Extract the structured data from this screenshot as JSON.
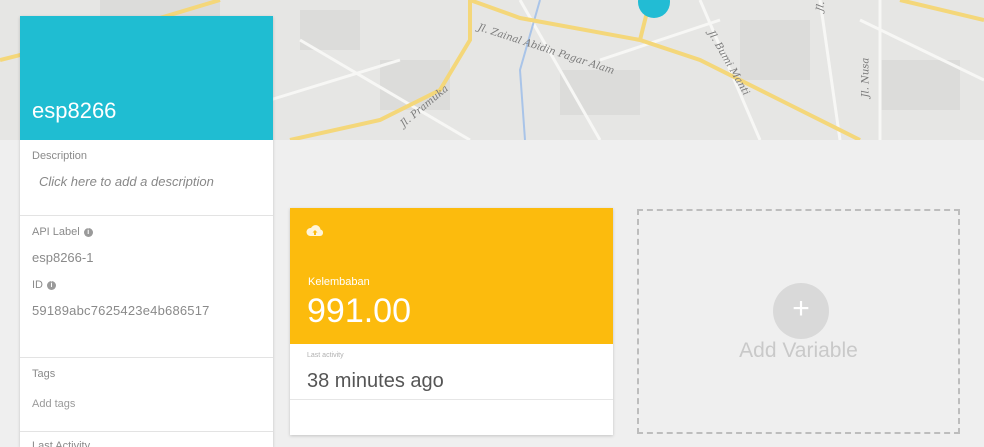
{
  "map": {
    "streets": [
      "Jl. Zainal Abidin Pagar Alam",
      "Jl. Pramuka",
      "Jl. Bumi Manti",
      "Jl. Urip",
      "Jl. Nusa"
    ],
    "pin_color": "#22bcd4"
  },
  "device": {
    "name": "esp8266",
    "header_color": "#1fbdd2",
    "description_label": "Description",
    "description_placeholder": "Click here to add a description",
    "api_label_label": "API Label",
    "api_label_value": "esp8266-1",
    "id_label": "ID",
    "id_value": "59189abc7625423e4b686517",
    "tags_label": "Tags",
    "tags_placeholder": "Add tags",
    "last_activity_label": "Last Activity"
  },
  "variable": {
    "name": "Kelembaban",
    "value": "991.00",
    "last_activity_label": "Last activity",
    "last_activity_value": "38 minutes ago",
    "color": "#fcbb0d",
    "icon": "cloud-icon"
  },
  "add_variable": {
    "label": "Add Variable",
    "icon": "plus-icon"
  }
}
